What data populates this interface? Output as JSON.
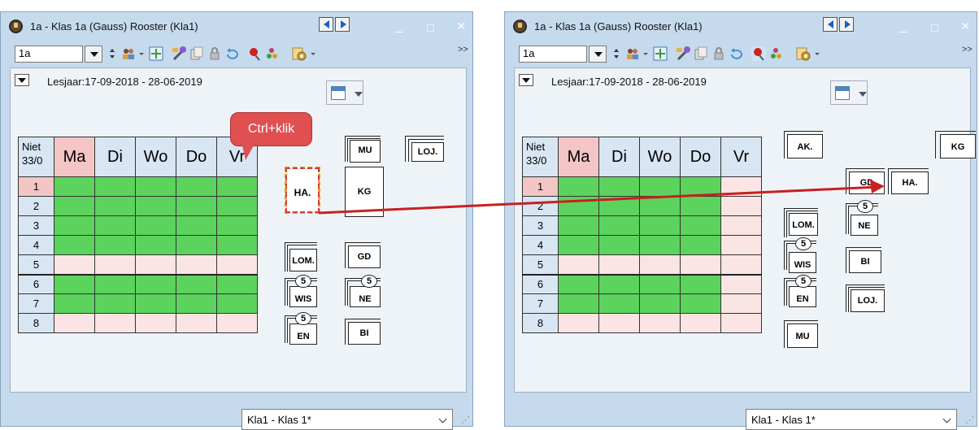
{
  "windows": [
    {
      "title": "1a - Klas 1a (Gauss)  Rooster  (Kla1)",
      "class_value": "1a",
      "lesjaar": "Lesjaar:17-09-2018 - 28-06-2019",
      "niet": "Niet",
      "niet_count": "33/0",
      "days": [
        "Ma",
        "Di",
        "Wo",
        "Do",
        "Vr"
      ],
      "hours": [
        "1",
        "2",
        "3",
        "4",
        "5",
        "6",
        "7",
        "8"
      ],
      "cards": [
        "MU",
        "LOJ.",
        "HA.",
        "KG",
        "LOM.",
        "GD",
        "WIS",
        "NE",
        "EN",
        "BI"
      ],
      "select_value": "Kla1 - Klas 1*"
    },
    {
      "title": "1a - Klas 1a (Gauss)  Rooster  (Kla1)",
      "class_value": "1a",
      "lesjaar": "Lesjaar:17-09-2018 - 28-06-2019",
      "niet": "Niet",
      "niet_count": "33/0",
      "days": [
        "Ma",
        "Di",
        "Wo",
        "Do",
        "Vr"
      ],
      "hours": [
        "1",
        "2",
        "3",
        "4",
        "5",
        "6",
        "7",
        "8"
      ],
      "cards": [
        "AK.",
        "KG",
        "GD",
        "HA.",
        "LOM.",
        "NE",
        "WIS",
        "BI",
        "EN",
        "LOJ.",
        "MU"
      ],
      "select_value": "Kla1 - Klas 1*"
    }
  ],
  "callout": "Ctrl+klik",
  "badge": "5",
  "window_buttons": {
    "minimize": "_",
    "maximize": "□",
    "close": "×"
  },
  "overflow": ">>",
  "icons": [
    "app-logo-icon",
    "nav-prev-icon",
    "nav-next-icon",
    "spin-icon",
    "people-icon",
    "grid-icon",
    "wand-icon",
    "copy-icon",
    "lock-icon",
    "undo-icon",
    "pin-icon",
    "users-icon",
    "settings-icon",
    "calendar-icon"
  ],
  "colors": {
    "green": "#5cd35c",
    "pink": "#fbe4e4",
    "header": "#d8e6f3",
    "monday": "#f4c5c5",
    "window": "#c6daee",
    "callout": "#e05050",
    "arrow": "#c82020"
  }
}
